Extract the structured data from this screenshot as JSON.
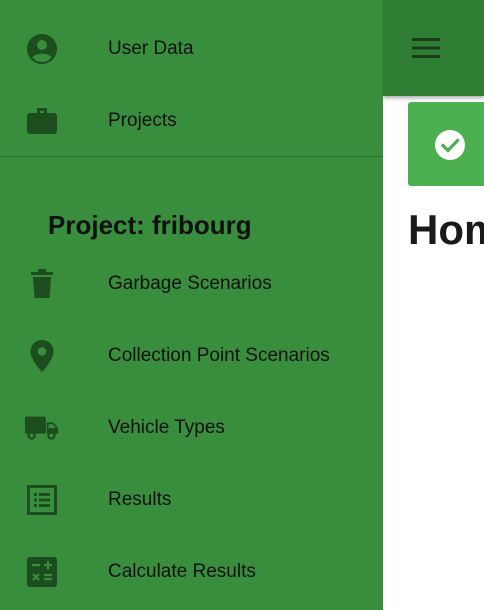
{
  "colors": {
    "drawer_bg": "#388e3c",
    "app_bar_bg": "#2e7d32",
    "success_bg": "#4caf50",
    "icon_color": "#1b4d1e"
  },
  "app_bar": {
    "menu_icon": "hamburger-menu-icon"
  },
  "success_banner": {
    "icon": "check-circle-icon"
  },
  "main": {
    "title": "Hom"
  },
  "drawer": {
    "top_items": [
      {
        "label": "User Data",
        "icon": "account-circle-icon"
      },
      {
        "label": "Projects",
        "icon": "briefcase-icon"
      }
    ],
    "section_header": "Project: fribourg",
    "project_items": [
      {
        "label": "Garbage Scenarios",
        "icon": "trash-icon"
      },
      {
        "label": "Collection Point Scenarios",
        "icon": "map-pin-icon"
      },
      {
        "label": "Vehicle Types",
        "icon": "truck-icon"
      },
      {
        "label": "Results",
        "icon": "list-icon"
      },
      {
        "label": "Calculate Results",
        "icon": "calculator-icon"
      }
    ]
  }
}
